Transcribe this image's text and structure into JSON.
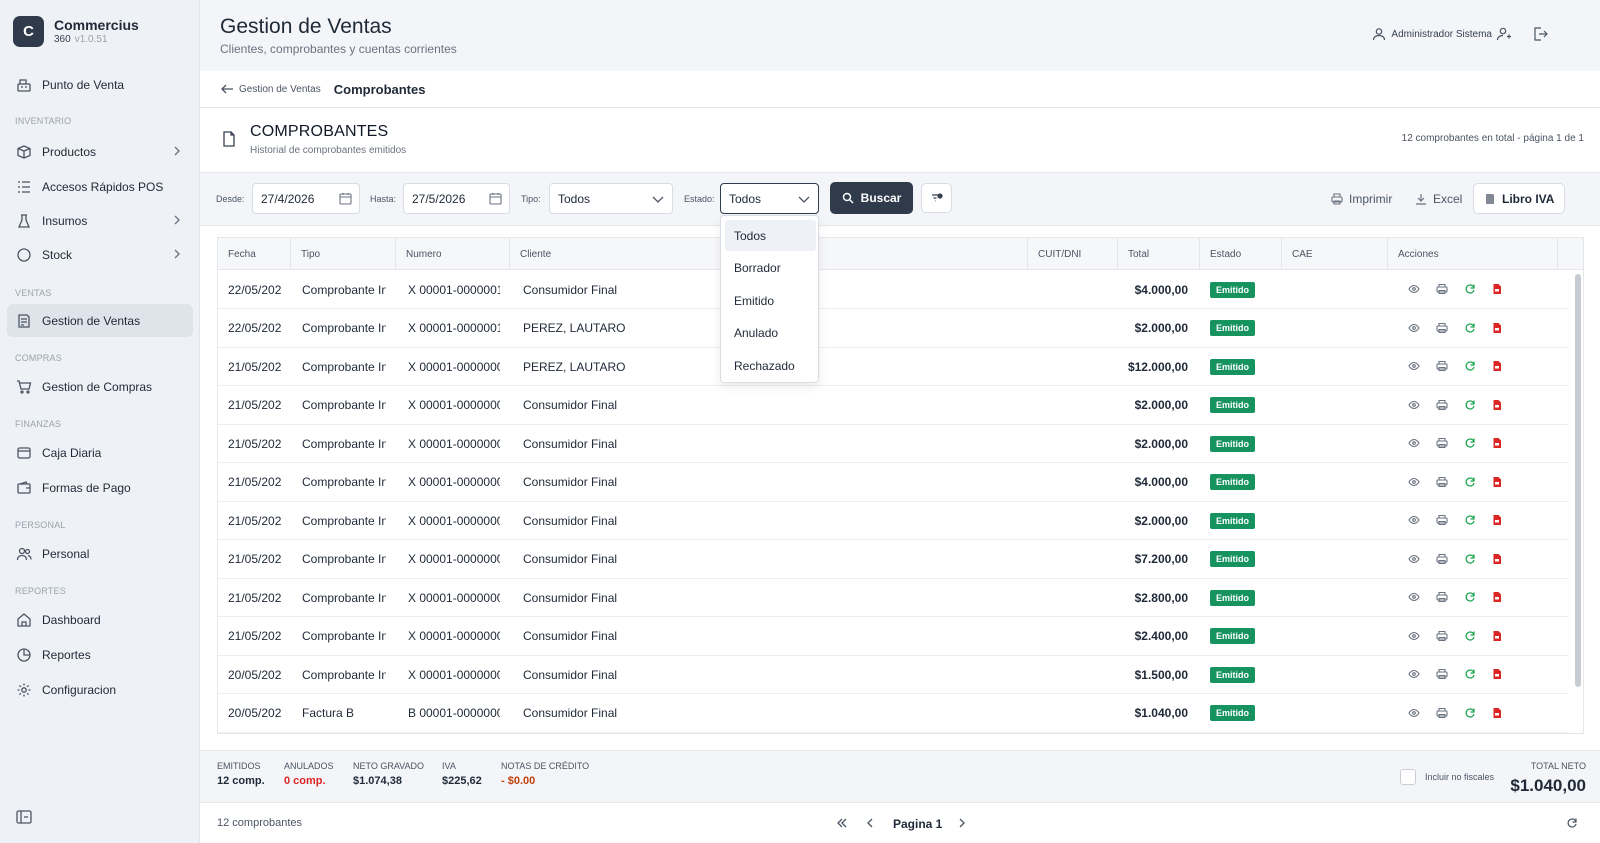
{
  "app": {
    "name": "Commercius",
    "product": "360",
    "version": "v1.0.51",
    "logo_letter": "C"
  },
  "sidebar": {
    "items": [
      {
        "label": "Punto de Venta",
        "icon": "register-icon"
      },
      {
        "section": "INVENTARIO"
      },
      {
        "label": "Productos",
        "icon": "box-icon",
        "chevron": true
      },
      {
        "label": "Accesos Rápidos POS",
        "icon": "list-icon"
      },
      {
        "label": "Insumos",
        "icon": "flask-icon",
        "chevron": true
      },
      {
        "label": "Stock",
        "icon": "circle-icon",
        "chevron": true
      },
      {
        "section": "VENTAS"
      },
      {
        "label": "Gestion de Ventas",
        "icon": "receipt-icon",
        "active": true
      },
      {
        "section": "COMPRAS"
      },
      {
        "label": "Gestion de Compras",
        "icon": "cart-icon"
      },
      {
        "section": "FINANZAS"
      },
      {
        "label": "Caja Diaria",
        "icon": "cash-icon"
      },
      {
        "label": "Formas de Pago",
        "icon": "wallet-icon"
      },
      {
        "section": "PERSONAL"
      },
      {
        "label": "Personal",
        "icon": "users-icon"
      },
      {
        "section": "REPORTES"
      },
      {
        "label": "Dashboard",
        "icon": "home-icon"
      },
      {
        "label": "Reportes",
        "icon": "pie-icon"
      },
      {
        "label": "Configuracion",
        "icon": "gear-icon"
      }
    ]
  },
  "header": {
    "title": "Gestion de Ventas",
    "subtitle": "Clientes, comprobantes y cuentas corrientes",
    "user": "Administrador Sistema"
  },
  "breadcrumb": {
    "parent": "Gestion de Ventas",
    "current": "Comprobantes"
  },
  "section": {
    "title": "COMPROBANTES",
    "subtitle": "Historial de comprobantes emitidos",
    "count_text": "12 comprobantes en total - página 1 de 1"
  },
  "filters": {
    "desde_label": "Desde:",
    "desde_value": "27/4/2026",
    "hasta_label": "Hasta:",
    "hasta_value": "27/5/2026",
    "tipo_label": "Tipo:",
    "tipo_value": "Todos",
    "estado_label": "Estado:",
    "estado_value": "Todos",
    "buscar_label": "Buscar",
    "imprimir_label": "Imprimir",
    "excel_label": "Excel",
    "libro_iva_label": "Libro IVA"
  },
  "estado_dropdown": {
    "options": [
      "Todos",
      "Borrador",
      "Emitido",
      "Anulado",
      "Rechazado"
    ],
    "selected": "Todos"
  },
  "table": {
    "columns": [
      "Fecha",
      "Tipo",
      "Numero",
      "Cliente",
      "CUIT/DNI",
      "Total",
      "Estado",
      "CAE",
      "Acciones"
    ],
    "rows": [
      {
        "fecha": "22/05/202",
        "tipo": "Comprobante In",
        "numero": "X 00001-0000001",
        "cliente": "Consumidor Final",
        "cuit": "",
        "total": "$4.000,00",
        "estado": "Emitido",
        "cae": ""
      },
      {
        "fecha": "22/05/202",
        "tipo": "Comprobante In",
        "numero": "X 00001-0000001(",
        "cliente": "PEREZ, LAUTARO",
        "cuit": "",
        "total": "$2.000,00",
        "estado": "Emitido",
        "cae": ""
      },
      {
        "fecha": "21/05/202",
        "tipo": "Comprobante In",
        "numero": "X 00001-0000000",
        "cliente": "PEREZ, LAUTARO",
        "cuit": "",
        "total": "$12.000,00",
        "estado": "Emitido",
        "cae": ""
      },
      {
        "fecha": "21/05/202",
        "tipo": "Comprobante In",
        "numero": "X 00001-0000000",
        "cliente": "Consumidor Final",
        "cuit": "",
        "total": "$2.000,00",
        "estado": "Emitido",
        "cae": ""
      },
      {
        "fecha": "21/05/202",
        "tipo": "Comprobante In",
        "numero": "X 00001-0000000",
        "cliente": "Consumidor Final",
        "cuit": "",
        "total": "$2.000,00",
        "estado": "Emitido",
        "cae": ""
      },
      {
        "fecha": "21/05/202",
        "tipo": "Comprobante In",
        "numero": "X 00001-0000000",
        "cliente": "Consumidor Final",
        "cuit": "",
        "total": "$4.000,00",
        "estado": "Emitido",
        "cae": ""
      },
      {
        "fecha": "21/05/202",
        "tipo": "Comprobante In",
        "numero": "X 00001-0000000",
        "cliente": "Consumidor Final",
        "cuit": "",
        "total": "$2.000,00",
        "estado": "Emitido",
        "cae": ""
      },
      {
        "fecha": "21/05/202",
        "tipo": "Comprobante In",
        "numero": "X 00001-0000000",
        "cliente": "Consumidor Final",
        "cuit": "",
        "total": "$7.200,00",
        "estado": "Emitido",
        "cae": ""
      },
      {
        "fecha": "21/05/202",
        "tipo": "Comprobante In",
        "numero": "X 00001-0000000",
        "cliente": "Consumidor Final",
        "cuit": "",
        "total": "$2.800,00",
        "estado": "Emitido",
        "cae": ""
      },
      {
        "fecha": "21/05/202",
        "tipo": "Comprobante In",
        "numero": "X 00001-0000000",
        "cliente": "Consumidor Final",
        "cuit": "",
        "total": "$2.400,00",
        "estado": "Emitido",
        "cae": ""
      },
      {
        "fecha": "20/05/202",
        "tipo": "Comprobante In",
        "numero": "X 00001-0000000",
        "cliente": "Consumidor Final",
        "cuit": "",
        "total": "$1.500,00",
        "estado": "Emitido",
        "cae": ""
      },
      {
        "fecha": "20/05/202",
        "tipo": "Factura B",
        "numero": "B 00001-0000000",
        "cliente": "Consumidor Final",
        "cuit": "",
        "total": "$1.040,00",
        "estado": "Emitido",
        "cae": ""
      }
    ],
    "actions": [
      "view-icon",
      "print-icon",
      "refresh-icon",
      "pdf-icon"
    ]
  },
  "totals": {
    "emitidos_label": "EMITIDOS",
    "emitidos_value": "12  comp.",
    "anulados_label": "ANULADOS",
    "anulados_value": "0  comp.",
    "neto_label": "NETO GRAVADO",
    "neto_value": "$1.074,38",
    "iva_label": "IVA",
    "iva_value": "$225,62",
    "nc_label": "NOTAS DE CRÉDITO",
    "nc_value": "- $0.00",
    "incluir_label": "Incluir no fiscales",
    "total_neto_label": "TOTAL NETO",
    "total_neto_value": "$1.040,00"
  },
  "footer": {
    "count": "12 comprobantes",
    "page_label": "Pagina 1"
  },
  "colors": {
    "primary": "#2f3b4b",
    "badge_green": "#16935f",
    "danger": "#dc2626",
    "warning": "#c2410c"
  }
}
